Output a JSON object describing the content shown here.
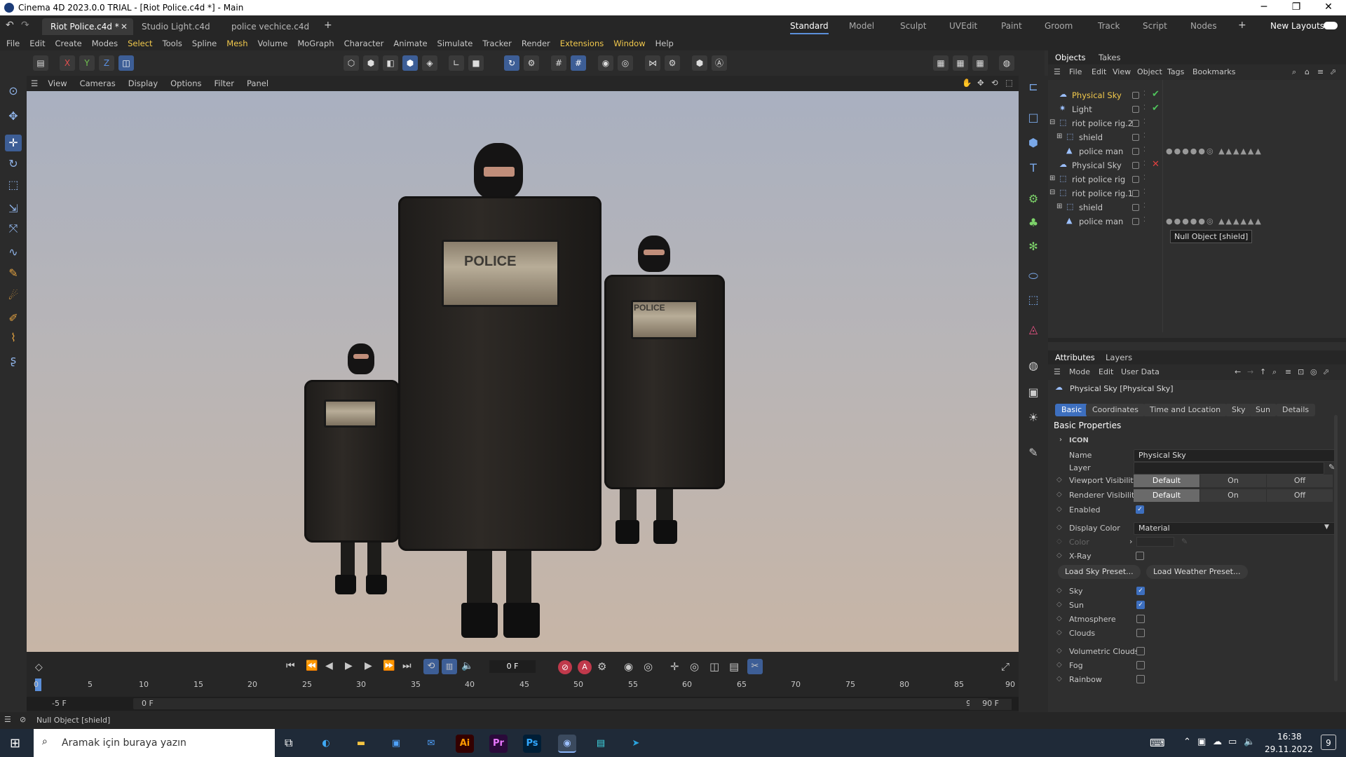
{
  "window": {
    "title": "Cinema 4D 2023.0.0 TRIAL - [Riot Police.c4d *] - Main",
    "minimize": "─",
    "maximize": "❐",
    "close": "✕"
  },
  "file_tabs": [
    {
      "label": "Riot Police.c4d *"
    },
    {
      "label": "Studio Light.c4d *"
    },
    {
      "label": "police vechice.c4d *"
    }
  ],
  "add_tab": "+",
  "layouts": [
    "Standard",
    "Model",
    "Sculpt",
    "UVEdit",
    "Paint",
    "Groom",
    "Track",
    "Script",
    "Nodes"
  ],
  "new_layouts": "New Layouts",
  "menu": [
    "File",
    "Edit",
    "Create",
    "Modes",
    "Select",
    "Tools",
    "Spline",
    "Mesh",
    "Volume",
    "MoGraph",
    "Character",
    "Animate",
    "Simulate",
    "Tracker",
    "Render",
    "Extensions",
    "Window",
    "Help"
  ],
  "axis": {
    "x": "X",
    "y": "Y",
    "z": "Z"
  },
  "viewport_menu": [
    "View",
    "Cameras",
    "Display",
    "Options",
    "Filter",
    "Panel"
  ],
  "scene": {
    "shield_text": "POLICE"
  },
  "objects_panel": {
    "tabs": [
      "Objects",
      "Takes"
    ],
    "menu": [
      "File",
      "Edit",
      "View",
      "Object",
      "Tags",
      "Bookmarks"
    ],
    "rows": [
      {
        "name": "Physical Sky",
        "highlight": true,
        "status": "✔"
      },
      {
        "name": "Light",
        "highlight": false,
        "status": "✔"
      },
      {
        "name": "riot police rig.2",
        "highlight": false,
        "status": ""
      },
      {
        "name": "shield",
        "highlight": false,
        "status": ""
      },
      {
        "name": "police man",
        "highlight": false,
        "status": ""
      },
      {
        "name": "Physical Sky",
        "highlight": false,
        "status": "✕"
      },
      {
        "name": "riot police rig",
        "highlight": false,
        "status": ""
      },
      {
        "name": "riot police rig.1",
        "highlight": false,
        "status": ""
      },
      {
        "name": "shield",
        "highlight": false,
        "status": ""
      },
      {
        "name": "police man",
        "highlight": false,
        "status": ""
      }
    ],
    "tooltip": "Null Object [shield]"
  },
  "attributes_panel": {
    "tabs": [
      "Attributes",
      "Layers"
    ],
    "menu": [
      "Mode",
      "Edit",
      "User Data"
    ],
    "object_title": "Physical Sky [Physical Sky]",
    "subtabs": [
      "Basic",
      "Coordinates",
      "Time and Location",
      "Sky",
      "Sun",
      "Details"
    ],
    "section": "Basic Properties",
    "icon_group": "ICON",
    "name_label": "Name",
    "name_value": "Physical Sky",
    "layer_label": "Layer",
    "viewport_visibility_label": "Viewport Visibility",
    "renderer_visibility_label": "Renderer Visibility",
    "vis_options": [
      "Default",
      "On",
      "Off"
    ],
    "enabled_label": "Enabled",
    "display_color_label": "Display Color",
    "display_color_value": "Material",
    "color_label": "Color",
    "xray_label": "X-Ray",
    "load_sky_preset": "Load Sky Preset...",
    "load_weather_preset": "Load Weather Preset...",
    "toggles": [
      {
        "label": "Sky",
        "checked": true
      },
      {
        "label": "Sun",
        "checked": true
      },
      {
        "label": "Atmosphere",
        "checked": false
      },
      {
        "label": "Clouds",
        "checked": false
      },
      {
        "label": "Volumetric Clouds",
        "checked": false
      },
      {
        "label": "Fog",
        "checked": false
      },
      {
        "label": "Rainbow",
        "checked": false
      }
    ]
  },
  "timeline": {
    "current_frame": "0 F",
    "ticks": [
      "0",
      "5",
      "10",
      "15",
      "20",
      "25",
      "30",
      "35",
      "40",
      "45",
      "50",
      "55",
      "60",
      "65",
      "70",
      "75",
      "80",
      "85",
      "90"
    ],
    "range_start": "-5 F",
    "range_min": "0 F",
    "range_max": "90 F",
    "range_end": "90 F"
  },
  "status": {
    "text": "Null Object [shield]"
  },
  "taskbar": {
    "search_placeholder": "Aramak için buraya yazın",
    "time": "16:38",
    "date": "29.11.2022",
    "notifications": "9",
    "apps": [
      {
        "label": "Ai",
        "color": "#ff9a00",
        "bg": "#330000"
      },
      {
        "label": "Pr",
        "color": "#ea77ff",
        "bg": "#2a0a3a"
      },
      {
        "label": "Ps",
        "color": "#31a8ff",
        "bg": "#001e36"
      }
    ]
  }
}
